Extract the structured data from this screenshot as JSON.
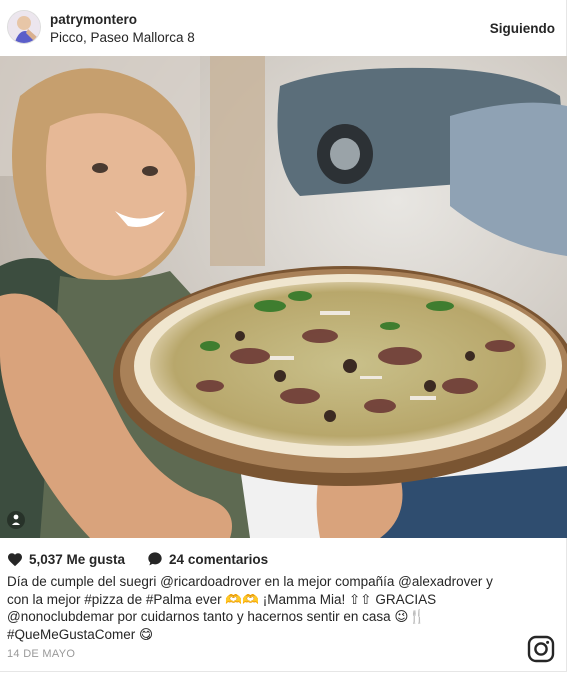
{
  "header": {
    "username": "patrymontero",
    "location": "Picco, Paseo Mallorca 8",
    "follow_label": "Siguiendo"
  },
  "photo": {
    "icons": {
      "multi": "single-image-icon"
    }
  },
  "actions": {
    "likes": "5,037 Me gusta",
    "comments": "24 comentarios",
    "icons": {
      "like": "heart-icon",
      "comment": "comment-bubble-icon"
    }
  },
  "caption": {
    "line1": "Día de cumple del suegri @ricardoadrover en la mejor compañía @alexadrover y",
    "line2": "con la mejor #pizza de #Palma ever 🫶🫶 ¡Mamma Mia! ⇧⇧ GRACIAS",
    "line3": "@nonoclubdemar por cuidarnos tanto y hacernos sentir en casa 😉🍴",
    "line4": "#QueMeGustaComer 😋"
  },
  "date": "14 DE MAYO",
  "colors": {
    "text": "#262626",
    "muted": "#999999",
    "border": "#e6e6e6"
  },
  "icons": {
    "brand": "instagram-logo-icon"
  }
}
